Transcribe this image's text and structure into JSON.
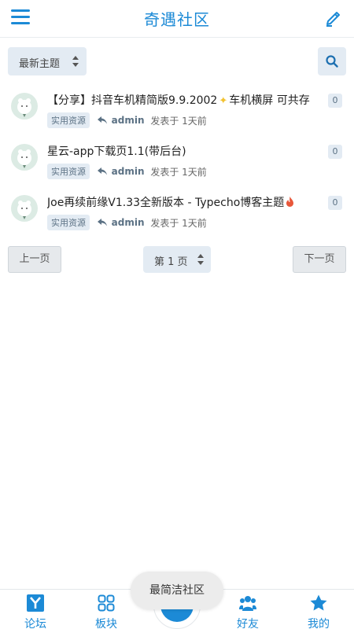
{
  "app": {
    "title": "奇遇社区"
  },
  "filter": {
    "sort_label": "最新主题"
  },
  "topics": [
    {
      "title": "【分享】抖音车机精简版9.9.2002",
      "title_suffix": "车机横屏 可共存",
      "title_emoji": "sparkles",
      "tag": "实用资源",
      "author": "admin",
      "posted": "发表于 1天前",
      "replies": "0"
    },
    {
      "title": "星云-app下载页1.1(带后台)",
      "title_suffix": "",
      "title_emoji": "",
      "tag": "实用资源",
      "author": "admin",
      "posted": "发表于 1天前",
      "replies": "0"
    },
    {
      "title": "Joe再续前缘V1.33全新版本 - Typecho博客主题",
      "title_suffix": "",
      "title_emoji": "fire",
      "tag": "实用资源",
      "author": "admin",
      "posted": "发表于 1天前",
      "replies": "0"
    }
  ],
  "pager": {
    "prev_label": "上一页",
    "page_label": "第 1 页",
    "next_label": "下一页"
  },
  "tabs": [
    {
      "label": "论坛",
      "icon": "forum-y-icon"
    },
    {
      "label": "板块",
      "icon": "grid-icon"
    },
    {
      "label": "好友",
      "icon": "friends-icon"
    },
    {
      "label": "我的",
      "icon": "star-icon"
    }
  ],
  "toast": {
    "text": "最简洁社区"
  },
  "colors": {
    "accent": "#1c8ad6",
    "chip_bg": "#e3ebf3",
    "chip_text": "#5b7184"
  }
}
